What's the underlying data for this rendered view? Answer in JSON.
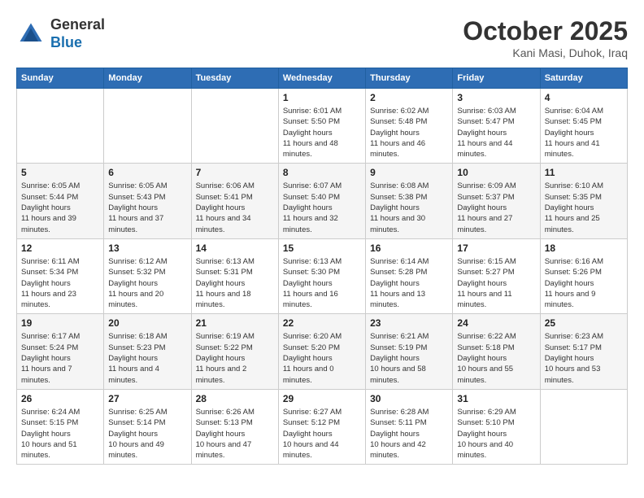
{
  "logo": {
    "line1": "General",
    "line2": "Blue"
  },
  "title": "October 2025",
  "subtitle": "Kani Masi, Duhok, Iraq",
  "weekdays": [
    "Sunday",
    "Monday",
    "Tuesday",
    "Wednesday",
    "Thursday",
    "Friday",
    "Saturday"
  ],
  "weeks": [
    [
      null,
      null,
      null,
      {
        "day": "1",
        "sunrise": "6:01 AM",
        "sunset": "5:50 PM",
        "daylight": "11 hours and 48 minutes."
      },
      {
        "day": "2",
        "sunrise": "6:02 AM",
        "sunset": "5:48 PM",
        "daylight": "11 hours and 46 minutes."
      },
      {
        "day": "3",
        "sunrise": "6:03 AM",
        "sunset": "5:47 PM",
        "daylight": "11 hours and 44 minutes."
      },
      {
        "day": "4",
        "sunrise": "6:04 AM",
        "sunset": "5:45 PM",
        "daylight": "11 hours and 41 minutes."
      }
    ],
    [
      {
        "day": "5",
        "sunrise": "6:05 AM",
        "sunset": "5:44 PM",
        "daylight": "11 hours and 39 minutes."
      },
      {
        "day": "6",
        "sunrise": "6:05 AM",
        "sunset": "5:43 PM",
        "daylight": "11 hours and 37 minutes."
      },
      {
        "day": "7",
        "sunrise": "6:06 AM",
        "sunset": "5:41 PM",
        "daylight": "11 hours and 34 minutes."
      },
      {
        "day": "8",
        "sunrise": "6:07 AM",
        "sunset": "5:40 PM",
        "daylight": "11 hours and 32 minutes."
      },
      {
        "day": "9",
        "sunrise": "6:08 AM",
        "sunset": "5:38 PM",
        "daylight": "11 hours and 30 minutes."
      },
      {
        "day": "10",
        "sunrise": "6:09 AM",
        "sunset": "5:37 PM",
        "daylight": "11 hours and 27 minutes."
      },
      {
        "day": "11",
        "sunrise": "6:10 AM",
        "sunset": "5:35 PM",
        "daylight": "11 hours and 25 minutes."
      }
    ],
    [
      {
        "day": "12",
        "sunrise": "6:11 AM",
        "sunset": "5:34 PM",
        "daylight": "11 hours and 23 minutes."
      },
      {
        "day": "13",
        "sunrise": "6:12 AM",
        "sunset": "5:32 PM",
        "daylight": "11 hours and 20 minutes."
      },
      {
        "day": "14",
        "sunrise": "6:13 AM",
        "sunset": "5:31 PM",
        "daylight": "11 hours and 18 minutes."
      },
      {
        "day": "15",
        "sunrise": "6:13 AM",
        "sunset": "5:30 PM",
        "daylight": "11 hours and 16 minutes."
      },
      {
        "day": "16",
        "sunrise": "6:14 AM",
        "sunset": "5:28 PM",
        "daylight": "11 hours and 13 minutes."
      },
      {
        "day": "17",
        "sunrise": "6:15 AM",
        "sunset": "5:27 PM",
        "daylight": "11 hours and 11 minutes."
      },
      {
        "day": "18",
        "sunrise": "6:16 AM",
        "sunset": "5:26 PM",
        "daylight": "11 hours and 9 minutes."
      }
    ],
    [
      {
        "day": "19",
        "sunrise": "6:17 AM",
        "sunset": "5:24 PM",
        "daylight": "11 hours and 7 minutes."
      },
      {
        "day": "20",
        "sunrise": "6:18 AM",
        "sunset": "5:23 PM",
        "daylight": "11 hours and 4 minutes."
      },
      {
        "day": "21",
        "sunrise": "6:19 AM",
        "sunset": "5:22 PM",
        "daylight": "11 hours and 2 minutes."
      },
      {
        "day": "22",
        "sunrise": "6:20 AM",
        "sunset": "5:20 PM",
        "daylight": "11 hours and 0 minutes."
      },
      {
        "day": "23",
        "sunrise": "6:21 AM",
        "sunset": "5:19 PM",
        "daylight": "10 hours and 58 minutes."
      },
      {
        "day": "24",
        "sunrise": "6:22 AM",
        "sunset": "5:18 PM",
        "daylight": "10 hours and 55 minutes."
      },
      {
        "day": "25",
        "sunrise": "6:23 AM",
        "sunset": "5:17 PM",
        "daylight": "10 hours and 53 minutes."
      }
    ],
    [
      {
        "day": "26",
        "sunrise": "6:24 AM",
        "sunset": "5:15 PM",
        "daylight": "10 hours and 51 minutes."
      },
      {
        "day": "27",
        "sunrise": "6:25 AM",
        "sunset": "5:14 PM",
        "daylight": "10 hours and 49 minutes."
      },
      {
        "day": "28",
        "sunrise": "6:26 AM",
        "sunset": "5:13 PM",
        "daylight": "10 hours and 47 minutes."
      },
      {
        "day": "29",
        "sunrise": "6:27 AM",
        "sunset": "5:12 PM",
        "daylight": "10 hours and 44 minutes."
      },
      {
        "day": "30",
        "sunrise": "6:28 AM",
        "sunset": "5:11 PM",
        "daylight": "10 hours and 42 minutes."
      },
      {
        "day": "31",
        "sunrise": "6:29 AM",
        "sunset": "5:10 PM",
        "daylight": "10 hours and 40 minutes."
      },
      null
    ]
  ],
  "labels": {
    "sunrise": "Sunrise:",
    "sunset": "Sunset:",
    "daylight": "Daylight hours"
  }
}
